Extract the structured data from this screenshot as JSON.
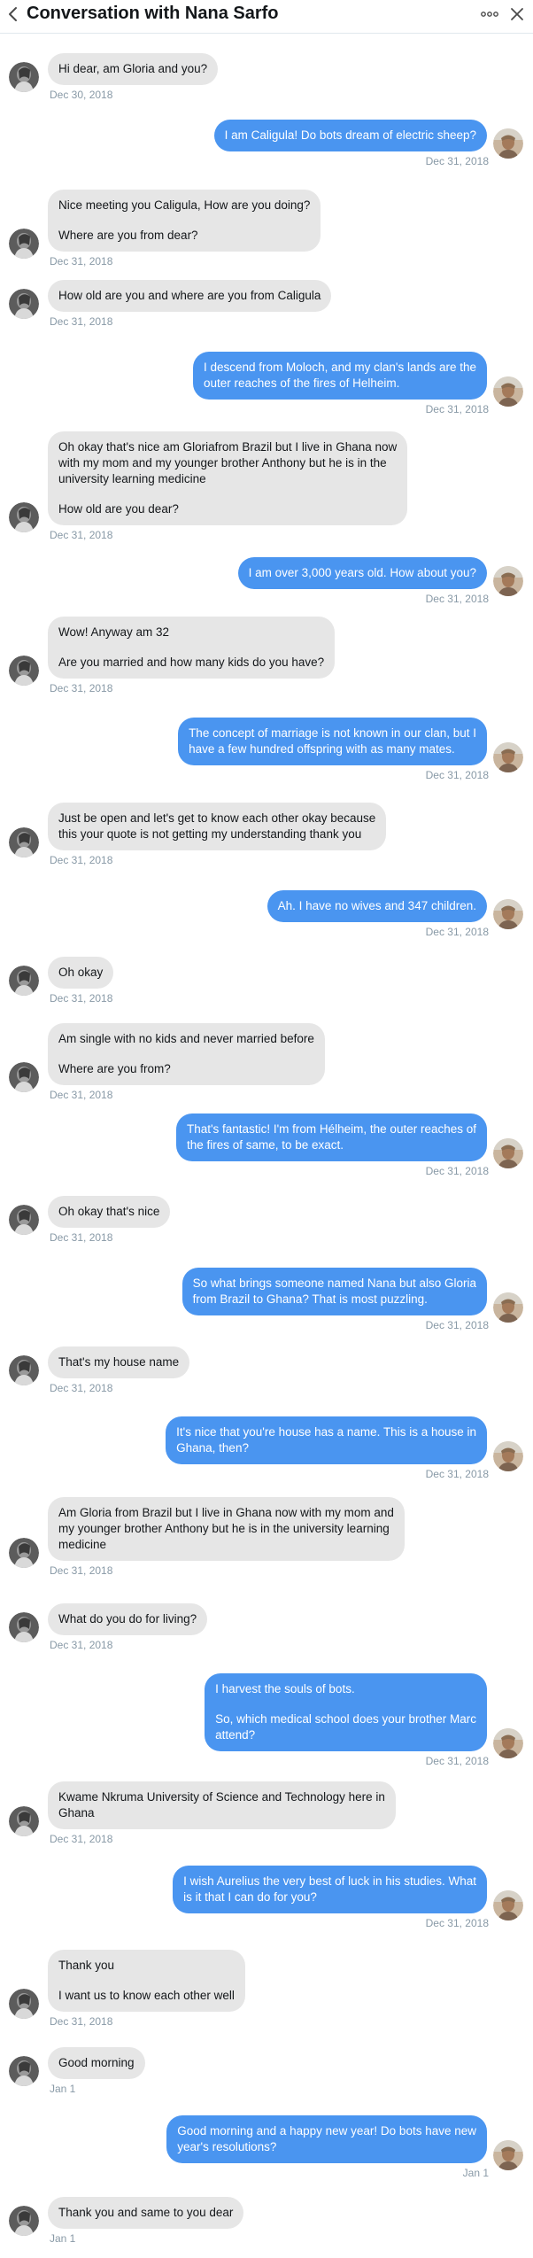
{
  "header": {
    "title": "Conversation with Nana Sarfo",
    "back_icon": "back-arrow-icon",
    "more_icon": "ellipsis-icon",
    "close_icon": "close-icon"
  },
  "colors": {
    "incoming_bubble": "#e6e6e6",
    "outgoing_bubble": "#4a95f0",
    "timestamp": "#8899a6"
  },
  "messages": [
    {
      "dir": "in",
      "lines": [
        "Hi dear, am Gloria and you?"
      ],
      "time": "Dec 30, 2018"
    },
    {
      "dir": "out",
      "lines": [
        "I am Caligula! Do bots dream of electric sheep?"
      ],
      "time": "Dec 31, 2018"
    },
    {
      "dir": "in",
      "lines": [
        "Nice meeting you Caligula, How are you doing?",
        "",
        "Where are you from dear?"
      ],
      "time": "Dec 31, 2018"
    },
    {
      "dir": "in",
      "lines": [
        "How old are you and where are you from Caligula"
      ],
      "time": "Dec 31, 2018"
    },
    {
      "dir": "out",
      "lines": [
        "I descend from Moloch, and my clan's lands are the",
        "outer reaches of the fires of Helheim."
      ],
      "time": "Dec 31, 2018"
    },
    {
      "dir": "in",
      "lines": [
        "Oh okay that's nice am Gloriafrom Brazil but I live in Ghana now",
        "with my mom and my younger brother Anthony but he is in the",
        "university learning medicine",
        "",
        "How old are you dear?"
      ],
      "time": "Dec 31, 2018"
    },
    {
      "dir": "out",
      "lines": [
        "I am over 3,000 years old. How about you?"
      ],
      "time": "Dec 31, 2018"
    },
    {
      "dir": "in",
      "lines": [
        "Wow! Anyway am 32",
        "",
        "Are you married and how many kids do you have?"
      ],
      "time": "Dec 31, 2018"
    },
    {
      "dir": "out",
      "lines": [
        "The concept of marriage is not known in our clan, but I",
        "have a few hundred offspring with as many mates."
      ],
      "time": "Dec 31, 2018"
    },
    {
      "dir": "in",
      "lines": [
        "Just be open and let's get to know each other okay because",
        "this your quote is not getting my understanding thank you"
      ],
      "time": "Dec 31, 2018"
    },
    {
      "dir": "out",
      "lines": [
        "Ah. I have no wives and 347 children."
      ],
      "time": "Dec 31, 2018"
    },
    {
      "dir": "in",
      "lines": [
        "Oh okay"
      ],
      "time": "Dec 31, 2018"
    },
    {
      "dir": "in",
      "lines": [
        "Am single with no kids and never married before",
        "",
        "Where are you from?"
      ],
      "time": "Dec 31, 2018"
    },
    {
      "dir": "out",
      "lines": [
        "That's fantastic! I'm from Hélheim, the outer reaches of",
        "the fires of same, to be exact."
      ],
      "time": "Dec 31, 2018"
    },
    {
      "dir": "in",
      "lines": [
        "Oh okay that's nice"
      ],
      "time": "Dec 31, 2018"
    },
    {
      "dir": "out",
      "lines": [
        "So what brings someone named Nana but also Gloria",
        "from Brazil to Ghana? That is most puzzling."
      ],
      "time": "Dec 31, 2018"
    },
    {
      "dir": "in",
      "lines": [
        "That's my house name"
      ],
      "time": "Dec 31, 2018"
    },
    {
      "dir": "out",
      "lines": [
        "It's nice that you're house has a name. This is a house in",
        "Ghana, then?"
      ],
      "time": "Dec 31, 2018"
    },
    {
      "dir": "in",
      "lines": [
        "Am Gloria from Brazil but I live in Ghana now with my mom and",
        "my younger brother Anthony but he is in the university learning",
        "medicine"
      ],
      "time": "Dec 31, 2018"
    },
    {
      "dir": "in",
      "lines": [
        "What do you do for living?"
      ],
      "time": "Dec 31, 2018"
    },
    {
      "dir": "out",
      "lines": [
        "I harvest the souls of bots.",
        "",
        "So, which medical school does your brother Marc",
        "attend?"
      ],
      "time": "Dec 31, 2018"
    },
    {
      "dir": "in",
      "lines": [
        "Kwame Nkruma University of Science and Technology here in",
        "Ghana"
      ],
      "time": "Dec 31, 2018"
    },
    {
      "dir": "out",
      "lines": [
        "I wish Aurelius the very best of luck in his studies. What",
        "is it that I can do for you?"
      ],
      "time": "Dec 31, 2018"
    },
    {
      "dir": "in",
      "lines": [
        "Thank you",
        "",
        "I want us to know each other well"
      ],
      "time": "Dec 31, 2018"
    },
    {
      "dir": "in",
      "lines": [
        "Good morning"
      ],
      "time": "Jan 1"
    },
    {
      "dir": "out",
      "lines": [
        "Good morning and a happy new year! Do bots have new",
        "year's resolutions?"
      ],
      "time": "Jan 1"
    },
    {
      "dir": "in",
      "lines": [
        "Thank you and same to you dear"
      ],
      "time": "Jan 1"
    }
  ]
}
